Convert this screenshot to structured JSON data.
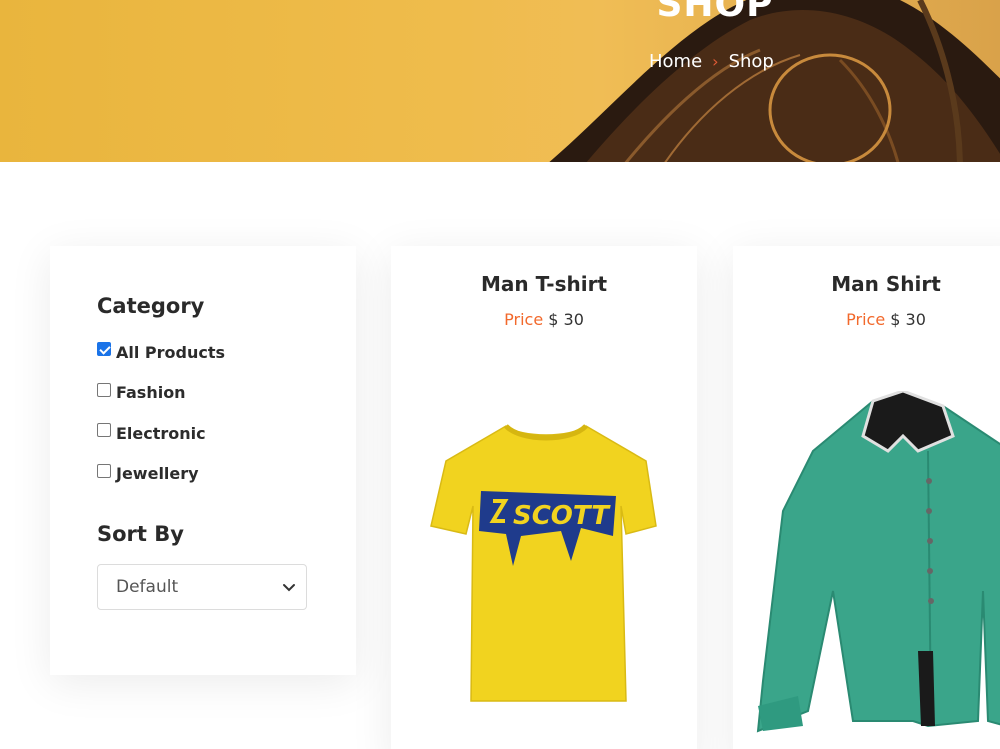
{
  "banner": {
    "title": "SHOP",
    "breadcrumb": {
      "home": "Home",
      "separator": "›",
      "current": "Shop"
    }
  },
  "sidebar": {
    "category_heading": "Category",
    "categories": [
      {
        "label": "All Products",
        "checked": true
      },
      {
        "label": "Fashion",
        "checked": false
      },
      {
        "label": "Electronic",
        "checked": false
      },
      {
        "label": "Jewellery",
        "checked": false
      }
    ],
    "sort_heading": "Sort By",
    "sort_select": {
      "value": "Default"
    }
  },
  "products": [
    {
      "name": "Man T-shirt",
      "price_label": "Price",
      "price_value": "$ 30",
      "image": "yellow-tshirt-image",
      "print_text": "SCOTT"
    },
    {
      "name": "Man Shirt",
      "price_label": "Price",
      "price_value": "$ 30",
      "image": "green-shirt-image"
    }
  ],
  "colors": {
    "accent": "#f2692c",
    "banner": "#efbc4c",
    "checkbox": "#1a73e8"
  }
}
